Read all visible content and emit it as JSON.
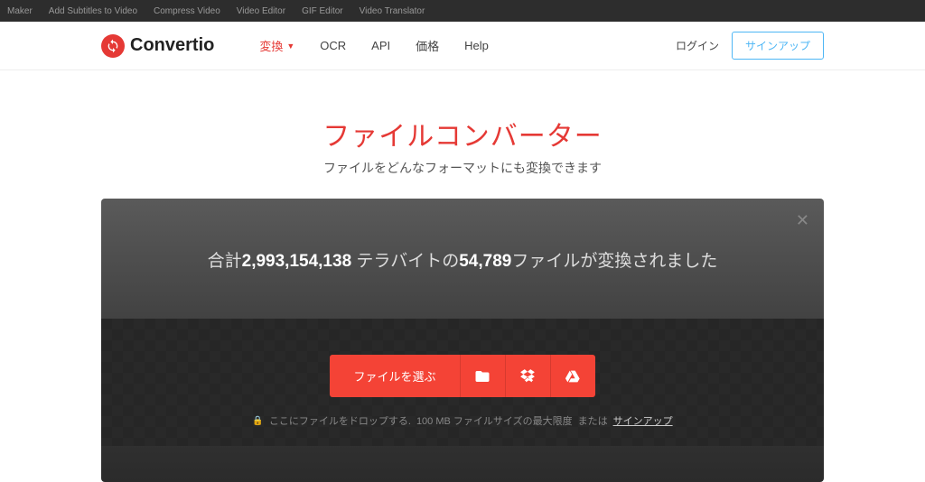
{
  "topbar": {
    "links": [
      "Maker",
      "Add Subtitles to Video",
      "Compress Video",
      "Video Editor",
      "GIF Editor",
      "Video Translator"
    ]
  },
  "brand": {
    "name": "Convertio"
  },
  "nav": {
    "convert": "変換",
    "ocr": "OCR",
    "api": "API",
    "pricing": "価格",
    "help": "Help",
    "login": "ログイン",
    "signup": "サインアップ"
  },
  "hero": {
    "title": "ファイルコンバーター",
    "subtitle": "ファイルをどんなフォーマットにも変換できます"
  },
  "stats": {
    "prefix": "合計",
    "files": "2,993,154,138",
    "mid": " テラバイトの",
    "tb": "54,789",
    "suffix": "ファイルが変換されました"
  },
  "picker": {
    "choose": "ファイルを選ぶ"
  },
  "hint": {
    "drop": "ここにファイルをドロップする.",
    "limit": "100 MB ファイルサイズの最大限度",
    "or": "または",
    "signup": "サインアップ"
  }
}
